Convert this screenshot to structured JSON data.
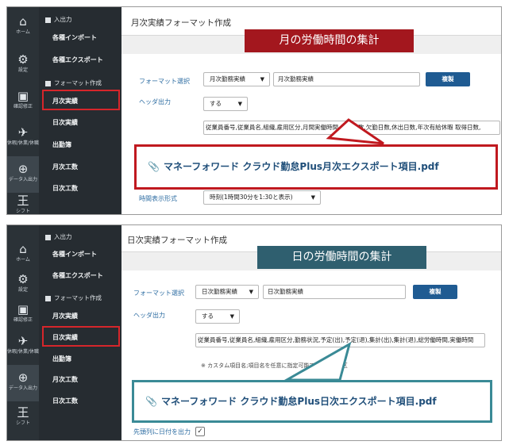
{
  "rail": {
    "home": "ホーム",
    "settings": "設定",
    "confirm": "確認修正",
    "leave": "休暇/休業/休職",
    "export": "データ入出力",
    "shift": "シフト"
  },
  "menu": {
    "io_heading": "入出力",
    "import": "各種インポート",
    "export": "各種エクスポート",
    "format_heading": "フォーマット作成",
    "monthly": "月次実績",
    "daily": "日次実績",
    "attendance": "出勤簿",
    "monthly_hours": "月次工数",
    "daily_hours": "日次工数"
  },
  "panel1": {
    "title": "月次実績フォーマット作成",
    "banner": "月の労働時間の集計",
    "banner_color": "#a3171e",
    "format_label": "フォーマット選択",
    "format_select": "月次勤務実績",
    "format_name": "月次勤務実績",
    "copy_button": "複製",
    "header_label": "ヘッダ出力",
    "header_select": "する",
    "columns_text": "従業員番号,従業員名,組織,雇用区分,月間実働時間,出勤日数,欠勤日数,休出日数,年次有給休暇 取得日数,",
    "callout_text": "マネーフォワード クラウド勤怠Plus月次エクスポート項目.pdf",
    "callout_color": "#c0191f",
    "time_label": "時間表示形式",
    "time_select": "時刻(1時間30分を1:30と表示)"
  },
  "panel2": {
    "title": "日次実績フォーマット作成",
    "banner": "日の労働時間の集計",
    "banner_color": "#2f5f6f",
    "format_label": "フォーマット選択",
    "format_select": "日次勤務実績",
    "format_name": "日次勤務実績",
    "copy_button": "複製",
    "header_label": "ヘッダ出力",
    "header_select": "する",
    "columns_text": "従業員番号,従業員名,組織,雇用区分,勤務状況,予定(出),予定(退),集計(出),集計(退),総労働時間,実働時間",
    "note": "※ カスタム項目名;項目名を任意に指定可能です。カンマ区",
    "callout_text": "マネーフォワード クラウド勤怠Plus日次エクスポート項目.pdf",
    "callout_color": "#3a8a96",
    "first_col_label": "先頭列に日付を出力",
    "first_col_check": "✓"
  }
}
